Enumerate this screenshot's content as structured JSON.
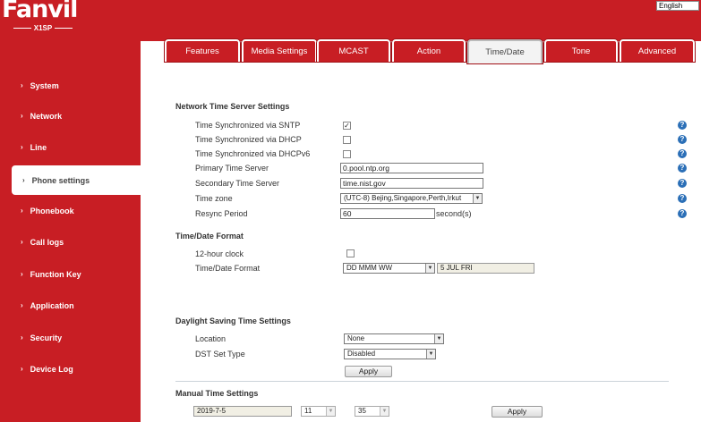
{
  "brand": {
    "name": "Fanvil",
    "model": "X1SP"
  },
  "language": "English",
  "sidebar": {
    "items": [
      {
        "label": "System"
      },
      {
        "label": "Network"
      },
      {
        "label": "Line"
      },
      {
        "label": "Phone settings",
        "active": true
      },
      {
        "label": "Phonebook"
      },
      {
        "label": "Call logs"
      },
      {
        "label": "Function Key"
      },
      {
        "label": "Application"
      },
      {
        "label": "Security"
      },
      {
        "label": "Device Log"
      }
    ]
  },
  "tabs": [
    {
      "label": "Features"
    },
    {
      "label": "Media Settings"
    },
    {
      "label": "MCAST"
    },
    {
      "label": "Action"
    },
    {
      "label": "Time/Date",
      "active": true
    },
    {
      "label": "Tone"
    },
    {
      "label": "Advanced"
    }
  ],
  "network_time": {
    "title": "Network Time Server Settings",
    "sntp_label": "Time Synchronized via SNTP",
    "sntp_checked": true,
    "dhcp_label": "Time Synchronized via DHCP",
    "dhcp_checked": false,
    "dhcpv6_label": "Time Synchronized via DHCPv6",
    "dhcpv6_checked": false,
    "primary_label": "Primary Time Server",
    "primary_value": "0.pool.ntp.org",
    "secondary_label": "Secondary Time Server",
    "secondary_value": "time.nist.gov",
    "timezone_label": "Time zone",
    "timezone_value": "(UTC-8) Bejing,Singapore,Perth,Irkut",
    "resync_label": "Resync Period",
    "resync_value": "60",
    "resync_unit": "second(s)"
  },
  "time_format": {
    "title": "Time/Date Format",
    "clock12_label": "12-hour clock",
    "clock12_checked": false,
    "format_label": "Time/Date Format",
    "format_value": "DD MMM WW",
    "preview": "5 JUL FRI"
  },
  "dst": {
    "title": "Daylight Saving Time Settings",
    "location_label": "Location",
    "location_value": "None",
    "type_label": "DST Set Type",
    "type_value": "Disabled",
    "apply_label": "Apply"
  },
  "manual": {
    "title": "Manual Time Settings",
    "date_value": "2019-7-5",
    "hour_value": "11",
    "minute_value": "35",
    "apply_label": "Apply"
  },
  "help_glyph": "?",
  "check_glyph": "✓",
  "arrow_glyph": "▼",
  "colors": {
    "brand_red": "#c81e24",
    "help_blue": "#2b6fb7"
  }
}
